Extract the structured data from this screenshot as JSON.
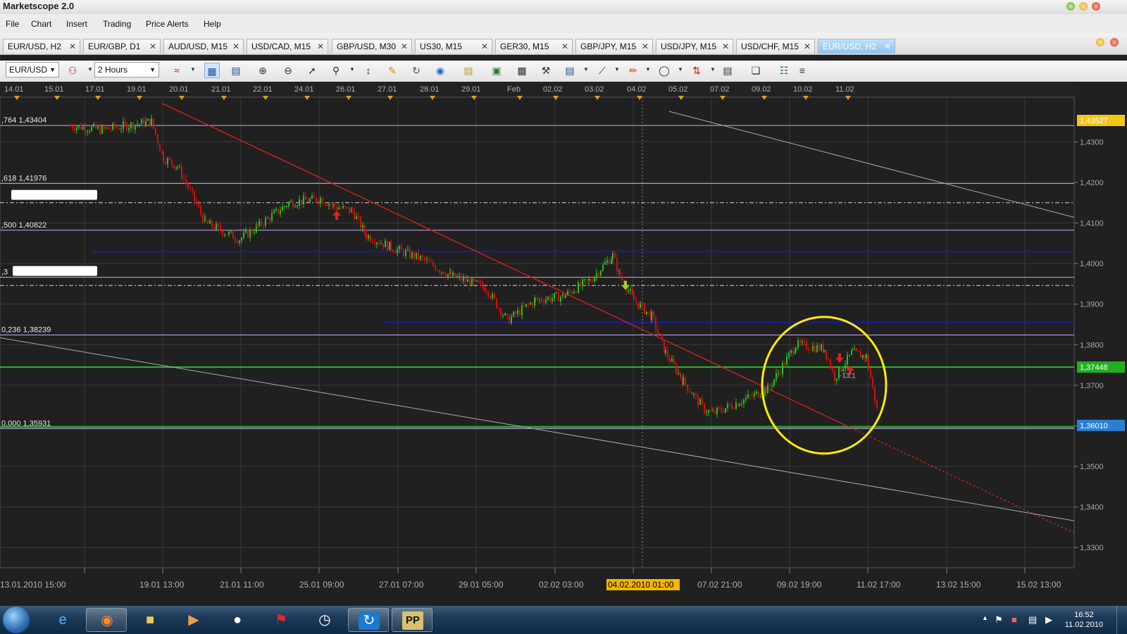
{
  "window": {
    "title": "Marketscope 2.0"
  },
  "menu": [
    "File",
    "Chart",
    "Insert",
    "Trading",
    "Price Alerts",
    "Help"
  ],
  "tabs": [
    {
      "label": "EUR/USD, H2",
      "active": false
    },
    {
      "label": "EUR/GBP, D1",
      "active": false
    },
    {
      "label": "AUD/USD, M15",
      "active": false
    },
    {
      "label": "USD/CAD, M15",
      "active": false
    },
    {
      "label": "GBP/USD, M30",
      "active": false
    },
    {
      "label": "US30, M15",
      "active": false
    },
    {
      "label": "GER30, M15",
      "active": false
    },
    {
      "label": "GBP/JPY, M15",
      "active": false
    },
    {
      "label": "USD/JPY, M15",
      "active": false
    },
    {
      "label": "USD/CHF, M15",
      "active": false
    },
    {
      "label": "EUR/USD, H2",
      "active": true
    }
  ],
  "tab_close_glyph": "✕",
  "toolbar": {
    "instrument": "EUR/USD",
    "timeframe": "2 Hours"
  },
  "chart_data": {
    "type": "candlestick",
    "instrument": "EUR/USD",
    "timeframe": "H2",
    "ylim": [
      1.325,
      1.441
    ],
    "yticks": [
      1.33,
      1.34,
      1.35,
      1.36,
      1.37,
      1.38,
      1.39,
      1.4,
      1.41,
      1.42,
      1.43
    ],
    "ytick_labels": [
      "1,3300",
      "1,3400",
      "1,3500",
      "1,3600",
      "1,3700",
      "1,3800",
      "1,3900",
      "1,4000",
      "1,4100",
      "1,4200",
      "1,4300"
    ],
    "top_date_labels": [
      "14.01",
      "15.01",
      "17.01",
      "19.01",
      "20.01",
      "21.01",
      "22.01",
      "24.01",
      "26.01",
      "27.01",
      "28.01",
      "29.01",
      "Feb",
      "02.02",
      "03.02",
      "04.02",
      "05.02",
      "07.02",
      "09.02",
      "10.02",
      "11.02"
    ],
    "bottom_date_labels": [
      "13.01.2010 15:00",
      "19.01 13:00",
      "21.01 11:00",
      "25.01 09:00",
      "27.01 07:00",
      "29.01 05:00",
      "02.02 03:00",
      "04.02.2010 01:00",
      "07.02 21:00",
      "09.02 19:00",
      "11.02 17:00",
      "13.02 15:00",
      "15.02 13:00"
    ],
    "highlighted_date": "04.02.2010 01:00",
    "price_labels": [
      {
        "value": 1.43527,
        "text": "1,43527",
        "color": "#f5c518"
      },
      {
        "value": 1.37448,
        "text": "1,37448",
        "color": "#22b022"
      },
      {
        "value": 1.3601,
        "text": "1,36010",
        "color": "#2a7fd4"
      }
    ],
    "fib_levels": [
      {
        "label": ",764 1,43404",
        "value": 1.43404
      },
      {
        "label": ",618 1,41976",
        "value": 1.41976
      },
      {
        "label": ",500 1,40822",
        "value": 1.40822
      },
      {
        "label": ",3",
        "value": 1.3966
      },
      {
        "label": "0,236 1,38239",
        "value": 1.38239
      },
      {
        "label": "0,000 1,35931",
        "value": 1.35931
      }
    ],
    "support_resistance": [
      {
        "value": 1.403,
        "color": "#1a1aa8"
      },
      {
        "value": 1.3855,
        "color": "#1a1aa8"
      },
      {
        "value": 1.37448,
        "color": "#22c022"
      },
      {
        "value": 1.3597,
        "color": "#22c022"
      }
    ],
    "dashed_levels": [
      1.415,
      1.3946
    ],
    "annotation": "-13,1",
    "colors": {
      "up": "#22c022",
      "down": "#d01010",
      "trend": "#e02020",
      "circle": "#ffee00",
      "background": "#202020",
      "grid": "#3a3a3a"
    }
  },
  "taskbar": {
    "clock_time": "16:52",
    "clock_date": "11.02.2010",
    "pinned_label": "PP"
  }
}
